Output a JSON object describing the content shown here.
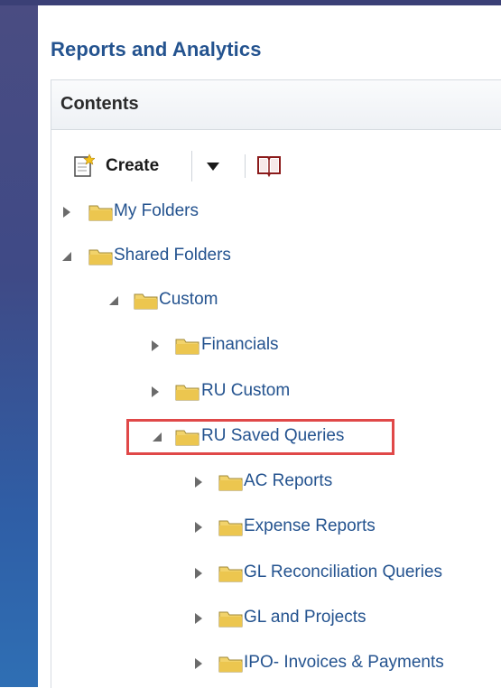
{
  "app": {
    "title": "Reports and Analytics"
  },
  "section": {
    "title": "Contents"
  },
  "toolbar": {
    "create_label": "Create",
    "create_icon": "new-document-icon",
    "dropdown_icon": "chevron-down-icon",
    "catalog_icon": "book-icon"
  },
  "colors": {
    "link": "#24538f",
    "highlight_border": "#e04848",
    "folder_fill": "#f2d36b"
  },
  "tree": {
    "items": [
      {
        "label": "My Folders",
        "expanded": false,
        "level": 0
      },
      {
        "label": "Shared Folders",
        "expanded": true,
        "level": 0
      },
      {
        "label": "Custom",
        "expanded": true,
        "level": 1
      },
      {
        "label": "Financials",
        "expanded": false,
        "level": 2
      },
      {
        "label": "RU Custom",
        "expanded": false,
        "level": 2
      },
      {
        "label": "RU Saved Queries",
        "expanded": true,
        "level": 2,
        "highlighted": true
      },
      {
        "label": "AC Reports",
        "expanded": false,
        "level": 3
      },
      {
        "label": "Expense Reports",
        "expanded": false,
        "level": 3
      },
      {
        "label": "GL Reconciliation Queries",
        "expanded": false,
        "level": 3
      },
      {
        "label": "GL and Projects",
        "expanded": false,
        "level": 3
      },
      {
        "label": "IPO- Invoices & Payments",
        "expanded": false,
        "level": 3
      }
    ]
  }
}
